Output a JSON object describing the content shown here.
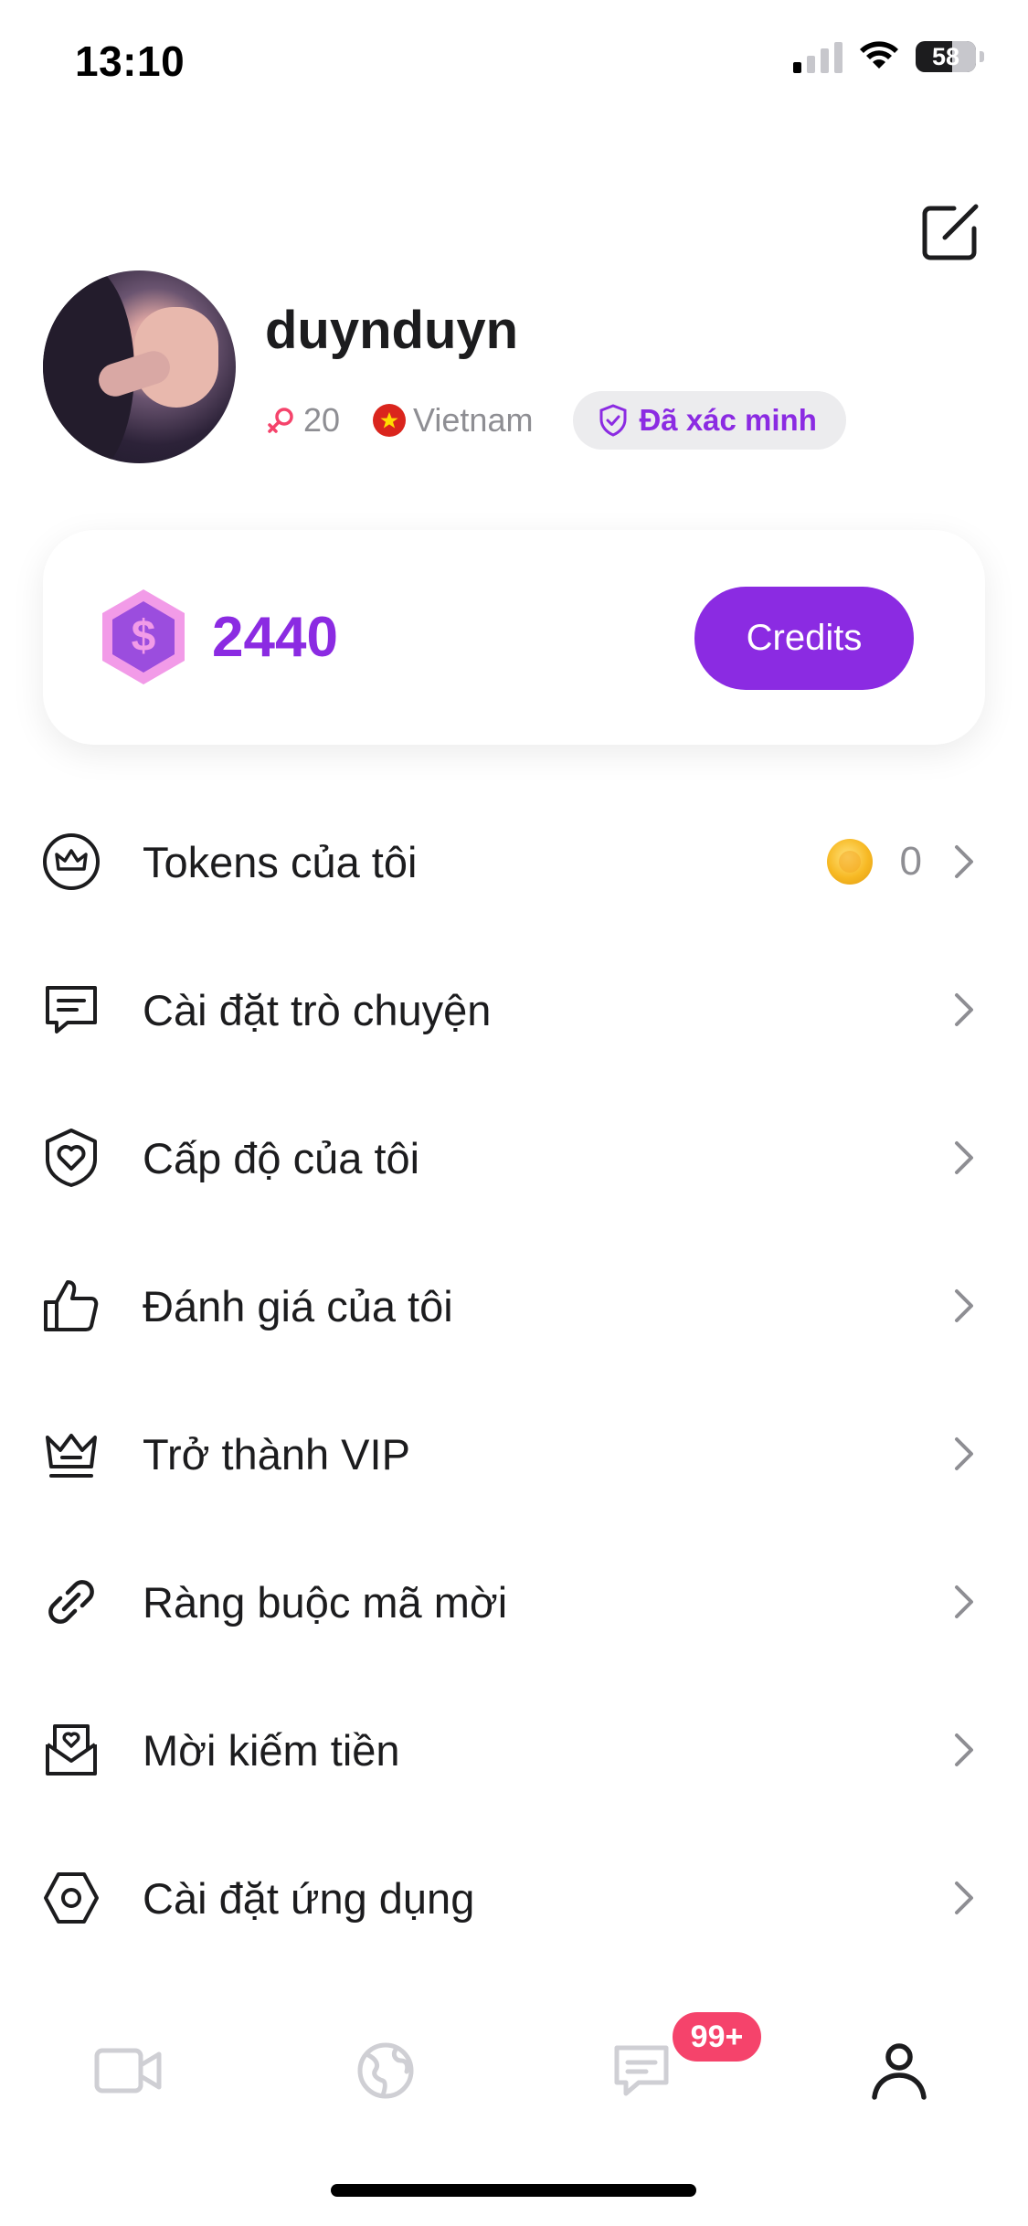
{
  "status_bar": {
    "time": "13:10",
    "battery": "58"
  },
  "profile": {
    "username": "duynduyn",
    "age": "20",
    "country": "Vietnam",
    "verified_label": "Đã xác minh",
    "gender_icon": "female-symbol-icon"
  },
  "credits": {
    "value": "2440",
    "button_label": "Credits",
    "icon": "dollar-hexagon-icon"
  },
  "menu": {
    "items": [
      {
        "label": "Tokens của tôi",
        "icon": "crown-circle-icon",
        "value": "0"
      },
      {
        "label": "Cài đặt trò chuyện",
        "icon": "chat-bubble-icon"
      },
      {
        "label": "Cấp độ của tôi",
        "icon": "heart-shield-icon"
      },
      {
        "label": "Đánh giá của tôi",
        "icon": "thumbs-up-icon"
      },
      {
        "label": "Trở thành VIP",
        "icon": "crown-icon"
      },
      {
        "label": "Ràng buộc mã mời",
        "icon": "link-icon"
      },
      {
        "label": "Mời kiếm tiền",
        "icon": "mail-heart-icon"
      },
      {
        "label": "Cài đặt ứng dụng",
        "icon": "settings-hexagon-icon"
      }
    ]
  },
  "tab_bar": {
    "tabs": [
      {
        "name": "video",
        "icon": "video-camera-icon",
        "active": false
      },
      {
        "name": "explore",
        "icon": "globe-icon",
        "active": false
      },
      {
        "name": "messages",
        "icon": "message-icon",
        "active": false
      },
      {
        "name": "profile",
        "icon": "person-icon",
        "active": true
      }
    ],
    "messages_badge": "99+"
  },
  "colors": {
    "accent": "#8b2be2",
    "badge": "#f5436b",
    "text_primary": "#1c1c1e",
    "text_secondary": "#8e8e93",
    "tab_inactive": "#cfcfd4"
  }
}
